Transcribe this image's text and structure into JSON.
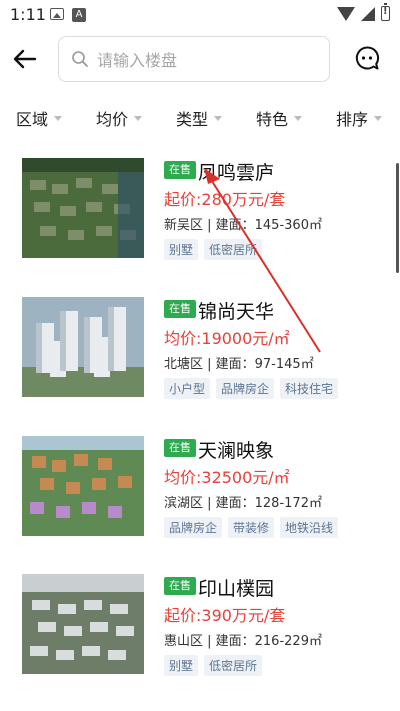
{
  "status_bar": {
    "time": "1:11",
    "notification_letter": "A"
  },
  "search": {
    "placeholder": "请输入楼盘",
    "value": ""
  },
  "filters": [
    {
      "label": "区域"
    },
    {
      "label": "均价"
    },
    {
      "label": "类型"
    },
    {
      "label": "特色"
    },
    {
      "label": "排序"
    }
  ],
  "listings": [
    {
      "status": "在售",
      "name": "凤鸣雲庐",
      "price": "起价:280万元/套",
      "meta": "新吴区 | 建面：145-360㎡",
      "tags": [
        "别墅",
        "低密居所"
      ]
    },
    {
      "status": "在售",
      "name": "锦尚天华",
      "price": "均价:19000元/㎡",
      "meta": "北塘区 | 建面：97-145㎡",
      "tags": [
        "小户型",
        "品牌房企",
        "科技住宅"
      ]
    },
    {
      "status": "在售",
      "name": "天澜映象",
      "price": "均价:32500元/㎡",
      "meta": "滨湖区 | 建面：128-172㎡",
      "tags": [
        "品牌房企",
        "带装修",
        "地铁沿线"
      ]
    },
    {
      "status": "在售",
      "name": "印山樸园",
      "price": "起价:390万元/套",
      "meta": "惠山区 | 建面：216-229㎡",
      "tags": [
        "别墅",
        "低密居所"
      ]
    }
  ],
  "colors": {
    "status_green": "#2eaa4f",
    "price_red": "#e8413a",
    "tag_bg": "#eef2f7",
    "tag_text": "#5d7491",
    "annotation_red": "#d9302b"
  },
  "icons": {
    "back": "arrow-left-icon",
    "search": "search-icon",
    "chat": "chat-bubble-icon"
  }
}
